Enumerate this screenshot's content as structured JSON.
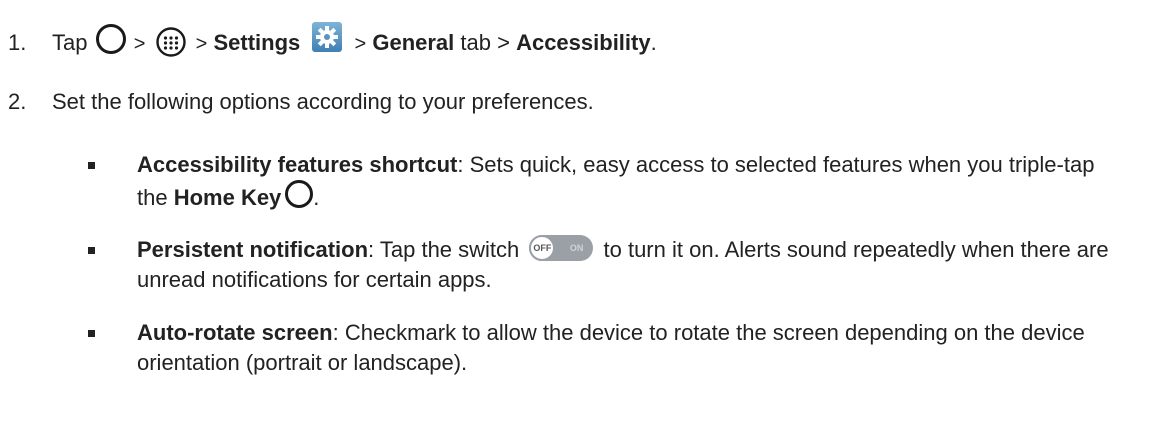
{
  "step1": {
    "number": "1.",
    "tap": "Tap",
    "sep1": ">",
    "sep2": ">",
    "settings": "Settings",
    "sep3": ">",
    "general": "General",
    "tab_sep": "tab >",
    "accessibility": "Accessibility",
    "period": "."
  },
  "step2": {
    "number": "2.",
    "text": "Set the following options according to your preferences."
  },
  "bullets": [
    {
      "title": "Accessibility features shortcut",
      "text_a": ": Sets quick, easy access to selected features when you triple-tap the ",
      "key": "Home Key",
      "text_b": "."
    },
    {
      "title": "Persistent notification",
      "text_a": ": Tap the switch ",
      "switch_off": "OFF",
      "switch_on": "ON",
      "text_b": " to turn it on. Alerts sound repeatedly when there are unread notifications for certain apps."
    },
    {
      "title": "Auto-rotate screen",
      "text": ": Checkmark to allow the device to rotate the screen depending on the device orientation (portrait or landscape)."
    }
  ],
  "icons": {
    "home": "home-circle-icon",
    "apps": "apps-grid-icon",
    "settings": "settings-gear-icon",
    "switch": "toggle-switch-icon"
  }
}
